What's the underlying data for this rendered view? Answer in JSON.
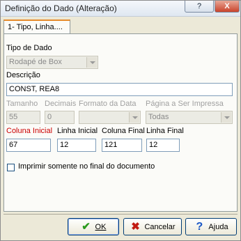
{
  "window": {
    "title": "Definição do Dado (Alteração)",
    "help_glyph": "?",
    "close_glyph": "X"
  },
  "tabs": [
    {
      "label": "1- Tipo, Linha....",
      "active": true
    }
  ],
  "fields": {
    "tipo_de_dado": {
      "label": "Tipo de Dado",
      "value": "Rodapé de Box"
    },
    "descricao": {
      "label": "Descrição",
      "value": "CONST, REA8"
    },
    "tamanho": {
      "label": "Tamanho",
      "value": "55"
    },
    "decimais": {
      "label": "Decimais",
      "value": "0"
    },
    "formato_da_data": {
      "label": "Formato da Data",
      "value": ""
    },
    "pagina_a_ser_impressa": {
      "label": "Página a Ser Impressa",
      "value": "Todas"
    },
    "coluna_inicial": {
      "label": "Coluna Inicial",
      "value": "67"
    },
    "linha_inicial": {
      "label": "Linha Inicial",
      "value": "12"
    },
    "coluna_final": {
      "label": "Coluna Final",
      "value": "121"
    },
    "linha_final": {
      "label": "Linha Final",
      "value": "12"
    }
  },
  "checkbox": {
    "label": "Imprimir somente no final do documento",
    "checked": false
  },
  "buttons": {
    "ok": {
      "label": "OK",
      "icon": "checkmark-icon"
    },
    "cancel": {
      "label": "Cancelar",
      "icon": "x-icon"
    },
    "help": {
      "label": "Ajuda",
      "icon": "question-icon"
    }
  },
  "colors": {
    "accent_required": "#cc0000",
    "tab_highlight": "#e68b2c"
  }
}
